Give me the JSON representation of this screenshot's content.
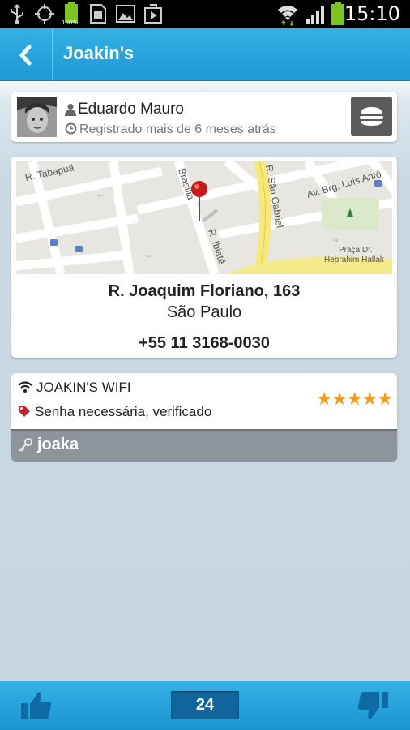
{
  "status_bar": {
    "time": "15:10",
    "battery_label": "100%",
    "icons": [
      "usb-icon",
      "gps-icon",
      "battery-full-icon",
      "sd-card-icon",
      "image-icon",
      "play-store-icon",
      "wifi-icon",
      "signal-icon",
      "battery-icon"
    ]
  },
  "header": {
    "title": "Joakin's",
    "back_icon": "chevron-left-icon"
  },
  "user": {
    "name": "Eduardo Mauro",
    "registered": "Registrado mais de 6 meses atrás",
    "category_icon": "burger-icon"
  },
  "location": {
    "map_labels": {
      "street1": "R. Tabapuã",
      "street2": "Brasília",
      "street3": "R. Ibiatê",
      "street4": "R. São Gabriel",
      "street5": "Av. Brg. Luís Antô",
      "park1": "Praça Dr.",
      "park2": "Hebrahim Hallak"
    },
    "address_line1": "R. Joaquim Floriano, 163",
    "address_line2": "São Paulo",
    "phone": "+55 11 3168-0030"
  },
  "wifi": {
    "name": "JOAKIN'S WIFI",
    "status": "Senha necessária, verificado",
    "rating": 5,
    "stars": "★★★★★",
    "password": "joaka"
  },
  "footer": {
    "vote_count": "24",
    "like_icon": "thumbs-up-icon",
    "dislike_icon": "thumbs-down-icon"
  },
  "colors": {
    "accent": "#1e98d4",
    "counter_bg": "#10669a",
    "star": "#f39a1a",
    "password_bar": "#8e959a"
  }
}
